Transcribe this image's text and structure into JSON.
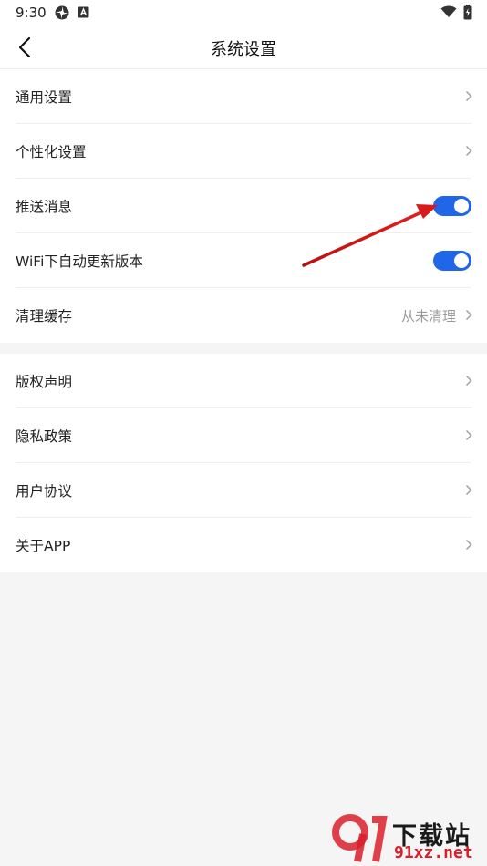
{
  "status_bar": {
    "time": "9:30",
    "icons": [
      "app-icon",
      "a-badge-icon",
      "wifi-icon",
      "battery-icon"
    ]
  },
  "header": {
    "title": "系统设置",
    "back_icon": "back-arrow-icon"
  },
  "group1": [
    {
      "label": "通用设置",
      "type": "link"
    },
    {
      "label": "个性化设置",
      "type": "link"
    },
    {
      "label": "推送消息",
      "type": "toggle",
      "on": true
    },
    {
      "label": "WiFi下自动更新版本",
      "type": "toggle",
      "on": true
    },
    {
      "label": "清理缓存",
      "type": "link",
      "value": "从未清理"
    }
  ],
  "group2": [
    {
      "label": "版权声明",
      "type": "link"
    },
    {
      "label": "隐私政策",
      "type": "link"
    },
    {
      "label": "用户协议",
      "type": "link"
    },
    {
      "label": "关于APP",
      "type": "link"
    }
  ],
  "watermark": {
    "cn": "下载站",
    "url": "91xz.net"
  },
  "colors": {
    "toggle_on": "#2066e8",
    "annotation_arrow": "#d71a1a",
    "watermark_red": "#d91e2a"
  }
}
